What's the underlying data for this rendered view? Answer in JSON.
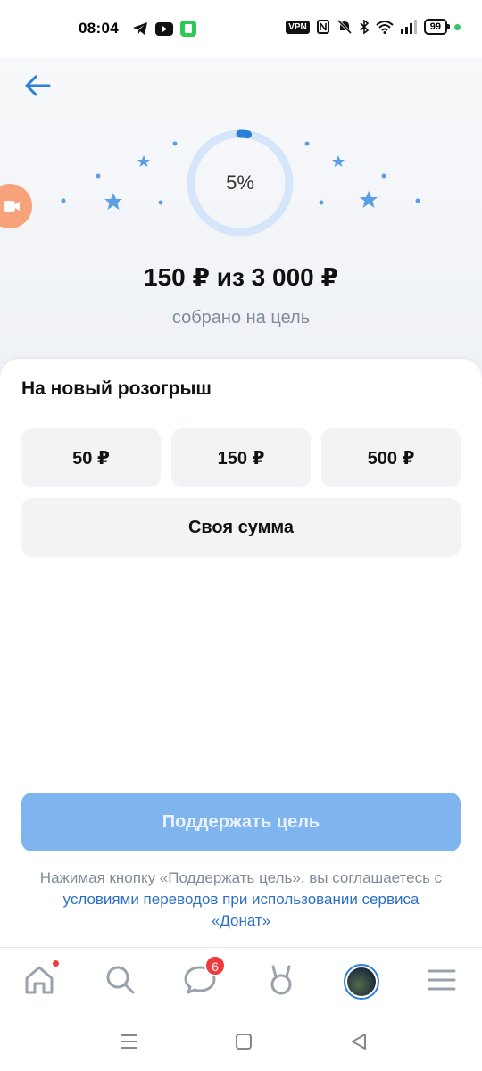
{
  "status_bar": {
    "time": "08:04",
    "vpn": "VPN",
    "battery": "99"
  },
  "goal": {
    "percent": "5%",
    "progress_fraction": 0.05,
    "amount_text": "150 ₽ из 3 000 ₽",
    "subtitle": "собрано на цель"
  },
  "donate": {
    "title": "На новый розогрыш",
    "amounts": [
      "50 ₽",
      "150 ₽",
      "500 ₽"
    ],
    "custom_label": "Своя сумма",
    "support_button": "Поддержать цель",
    "terms_prefix": "Нажимая кнопку «Поддержать цель», вы соглашаетесь с ",
    "terms_link": "условиями переводов при использовании сервиса «Донат»"
  },
  "tabbar": {
    "messages_badge": "6",
    "items": [
      "home-icon",
      "search-icon",
      "messages-icon",
      "services-icon",
      "profile-avatar",
      "menu-icon"
    ]
  },
  "colors": {
    "accent": "#2a7fd6",
    "button_disabled": "#7fb4ee",
    "chip_bg": "#f2f3f5",
    "muted_text": "#818c99",
    "badge": "#ef3b3b",
    "progress_track": "#d6e6fa",
    "star": "#5c9ee6"
  }
}
